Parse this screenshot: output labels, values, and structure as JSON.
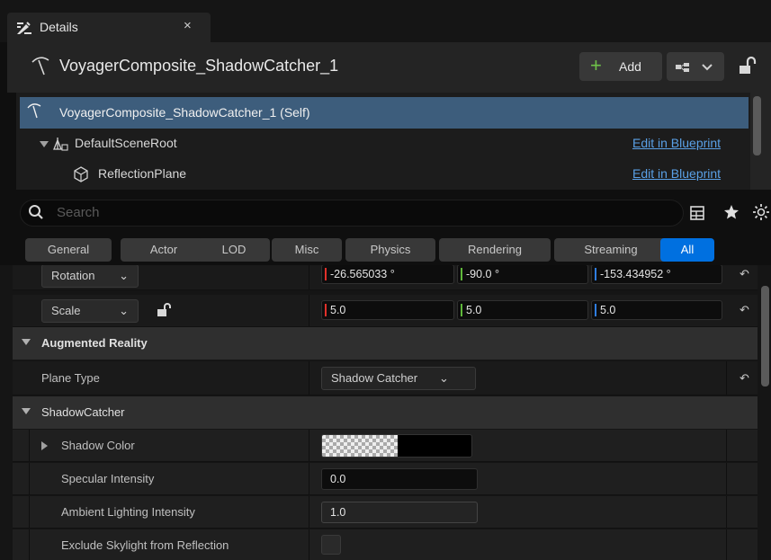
{
  "tab": {
    "label": "Details",
    "close": "×"
  },
  "header": {
    "actor_name": "VoyagerComposite_ShadowCatcher_1",
    "add_label": "Add"
  },
  "tree": {
    "self_label": "VoyagerComposite_ShadowCatcher_1 (Self)",
    "items": [
      {
        "label": "DefaultSceneRoot",
        "link": "Edit in Blueprint"
      },
      {
        "label": "ReflectionPlane",
        "link": "Edit in Blueprint"
      }
    ]
  },
  "search": {
    "placeholder": "Search"
  },
  "categories": [
    "General",
    "Actor",
    "LOD",
    "Misc",
    "Physics",
    "Rendering",
    "Streaming",
    "All"
  ],
  "active_category": "All",
  "transform": {
    "rotation": {
      "label": "Rotation",
      "x": "-26.565033 °",
      "y": "-90.0 °",
      "z": "-153.434952 °"
    },
    "scale": {
      "label": "Scale",
      "x": "5.0",
      "y": "5.0",
      "z": "5.0"
    }
  },
  "augmented_reality": {
    "section_label": "Augmented Reality",
    "plane_type_label": "Plane Type",
    "plane_type_value": "Shadow Catcher"
  },
  "shadow_catcher": {
    "section_label": "ShadowCatcher",
    "shadow_color_label": "Shadow Color",
    "specular_label": "Specular Intensity",
    "specular_value": "0.0",
    "ambient_label": "Ambient Lighting Intensity",
    "ambient_value": "1.0",
    "exclude_skylight_label": "Exclude Skylight from Reflection",
    "exclude_skylight_checked": false
  },
  "colors": {
    "accent": "#0070e0",
    "x_axis": "#e0302a",
    "y_axis": "#5fb83a",
    "z_axis": "#2f7de0",
    "selection": "#3d5d7c"
  }
}
